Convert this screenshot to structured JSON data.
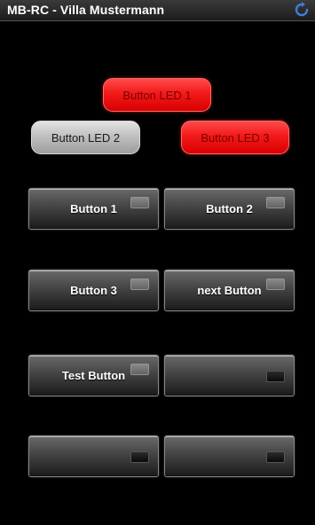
{
  "app": {
    "title": "MB-RC - Villa Mustermann"
  },
  "leds": [
    {
      "label": "Button LED 1",
      "state": "on",
      "color": "#f21a1a"
    },
    {
      "label": "Button LED 2",
      "state": "off",
      "color": "#bdbdbd"
    },
    {
      "label": "Button LED 3",
      "state": "on",
      "color": "#f21a1a"
    }
  ],
  "buttons": [
    {
      "label": "Button 1",
      "indicator": "off"
    },
    {
      "label": "Button 2",
      "indicator": "off"
    },
    {
      "label": "Button 3",
      "indicator": "off"
    },
    {
      "label": "next Button",
      "indicator": "off"
    },
    {
      "label": "Test Button",
      "indicator": "off"
    },
    {
      "label": "",
      "indicator": "dark"
    },
    {
      "label": "",
      "indicator": "dark"
    },
    {
      "label": "",
      "indicator": "dark"
    }
  ],
  "icons": {
    "refresh": "refresh-icon"
  },
  "colors": {
    "background": "#000000",
    "led_on": "#f21a1a",
    "led_off": "#bdbdbd"
  }
}
